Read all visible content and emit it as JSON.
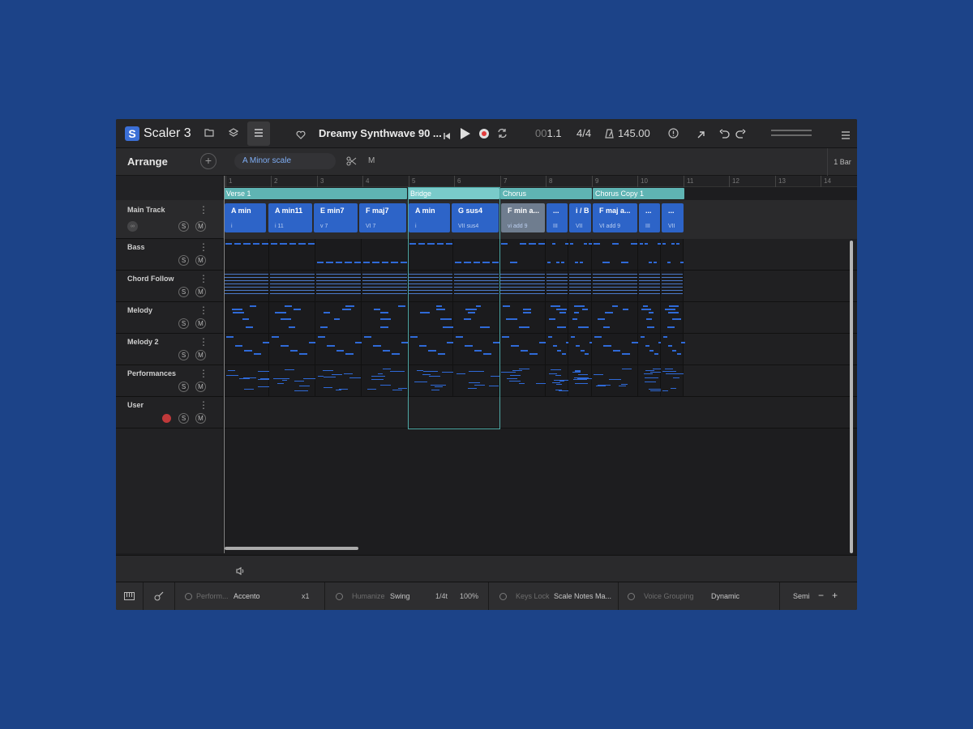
{
  "app": {
    "logo_letter": "S",
    "name": "Scaler 3"
  },
  "toolbar": {
    "song_title": "Dreamy Synthwave 90 ...",
    "position": "001.1",
    "position_dim": "00",
    "position_main": "1.1",
    "time_signature": "4/4",
    "tempo": "145.00"
  },
  "arrange": {
    "title": "Arrange",
    "scale": "A Minor scale",
    "mode_label": "M",
    "bar_length": "1 Bar"
  },
  "ruler": [
    "1",
    "2",
    "3",
    "4",
    "5",
    "6",
    "7",
    "8",
    "9",
    "10",
    "11",
    "12",
    "13",
    "14"
  ],
  "sections": [
    {
      "label": "Verse 1"
    },
    {
      "label": "Bridge"
    },
    {
      "label": "Chorus"
    },
    {
      "label": "Chorus Copy 1"
    }
  ],
  "main_track": {
    "name": "Main Track",
    "chords": [
      {
        "name": "A min",
        "roman": "i"
      },
      {
        "name": "A min11",
        "roman": "i 11"
      },
      {
        "name": "E min7",
        "roman": "v 7"
      },
      {
        "name": "F maj7",
        "roman": "VI 7"
      },
      {
        "name": "A min",
        "roman": "i"
      },
      {
        "name": "G sus4",
        "roman": "VII sus4"
      },
      {
        "name": "F min a...",
        "roman": "vi add 9"
      },
      {
        "name": "...",
        "roman": "III"
      },
      {
        "name": "i / B",
        "roman": "VII"
      },
      {
        "name": "F maj a...",
        "roman": "VI add 9"
      },
      {
        "name": "...",
        "roman": "III"
      },
      {
        "name": "...",
        "roman": "VII"
      }
    ]
  },
  "tracks": [
    {
      "name": "Bass",
      "solo": "S",
      "mute": "M"
    },
    {
      "name": "Chord Follow",
      "solo": "S",
      "mute": "M"
    },
    {
      "name": "Melody",
      "solo": "S",
      "mute": "M"
    },
    {
      "name": "Melody 2",
      "solo": "S",
      "mute": "M"
    },
    {
      "name": "Performances",
      "solo": "S",
      "mute": "M"
    },
    {
      "name": "User",
      "solo": "S",
      "mute": "M"
    }
  ],
  "footer": {
    "perform_label": "Perform...",
    "perform_value": "Accento",
    "multiplier": "x1",
    "humanize_label": "Humanize",
    "swing_label": "Swing",
    "rate": "1/4t",
    "percent": "100%",
    "keys_lock_label": "Keys Lock",
    "keys_lock_value": "Scale Notes Ma...",
    "voice_grouping_label": "Voice Grouping",
    "voice_grouping_value": "Dynamic",
    "semi_label": "Semi",
    "minus": "−",
    "plus": "+"
  },
  "icons": [
    "scaler-logo-icon",
    "folder-icon",
    "layers-icon",
    "menu-icon",
    "heart-icon",
    "skip-back-icon",
    "play-icon",
    "record-icon",
    "loop-icon",
    "metronome-icon",
    "info-icon",
    "export-icon",
    "undo-icon",
    "redo-icon",
    "hamburger-icon",
    "add-icon",
    "scissors-icon",
    "speaker-icon",
    "keyboard-icon",
    "guitar-icon"
  ],
  "colors": {
    "accent": "#2d64c8",
    "section": "#5fb4b3",
    "background": "#1c4388",
    "record": "#e23b3b"
  }
}
